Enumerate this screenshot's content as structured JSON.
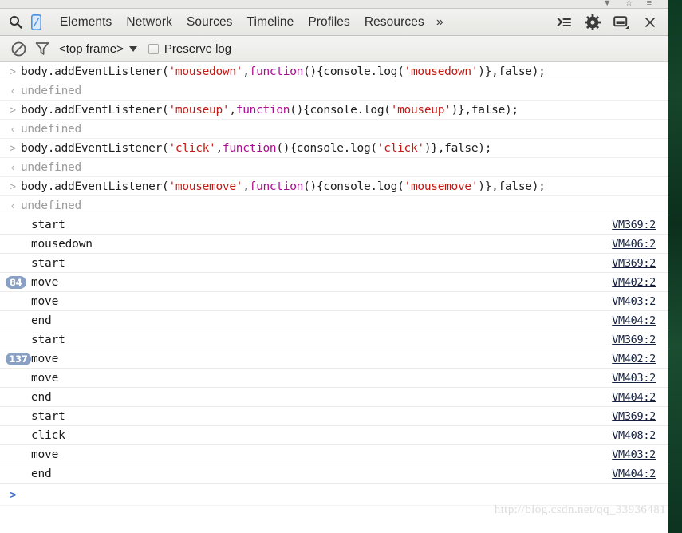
{
  "window": {
    "chrome_glyphs": "▼ ☆ ≡"
  },
  "toolbar": {
    "search_icon": "search-icon",
    "device_icon": "device-toggle-icon",
    "tabs": [
      {
        "label": "Elements"
      },
      {
        "label": "Network"
      },
      {
        "label": "Sources"
      },
      {
        "label": "Timeline"
      },
      {
        "label": "Profiles"
      },
      {
        "label": "Resources"
      }
    ],
    "overflow_label": "»",
    "right_icons": [
      {
        "name": "console-drawer-icon"
      },
      {
        "name": "gear-icon"
      },
      {
        "name": "dock-position-icon"
      },
      {
        "name": "close-icon"
      }
    ],
    "close_label": "×"
  },
  "filterbar": {
    "clear_icon": "clear-console-icon",
    "filter_icon": "filter-icon",
    "frame_label": "<top frame>",
    "frame_caret": "caret-down-icon",
    "preserve_log_label": "Preserve log",
    "preserve_log_checked": false
  },
  "console": {
    "input_marker": ">",
    "output_marker": "‹",
    "entries": [
      {
        "type": "command",
        "marker": ">",
        "tokens": [
          {
            "t": "plain",
            "v": "body.addEventListener("
          },
          {
            "t": "string",
            "v": "'mousedown'"
          },
          {
            "t": "plain",
            "v": ","
          },
          {
            "t": "keyword",
            "v": "function"
          },
          {
            "t": "plain",
            "v": "(){console.log("
          },
          {
            "t": "string",
            "v": "'mousedown'"
          },
          {
            "t": "plain",
            "v": ")},false);"
          }
        ]
      },
      {
        "type": "result",
        "marker": "‹",
        "text": "undefined"
      },
      {
        "type": "command",
        "marker": ">",
        "tokens": [
          {
            "t": "plain",
            "v": "body.addEventListener("
          },
          {
            "t": "string",
            "v": "'mouseup'"
          },
          {
            "t": "plain",
            "v": ","
          },
          {
            "t": "keyword",
            "v": "function"
          },
          {
            "t": "plain",
            "v": "(){console.log("
          },
          {
            "t": "string",
            "v": "'mouseup'"
          },
          {
            "t": "plain",
            "v": ")},false);"
          }
        ]
      },
      {
        "type": "result",
        "marker": "‹",
        "text": "undefined"
      },
      {
        "type": "command",
        "marker": ">",
        "tokens": [
          {
            "t": "plain",
            "v": "body.addEventListener("
          },
          {
            "t": "string",
            "v": "'click'"
          },
          {
            "t": "plain",
            "v": ","
          },
          {
            "t": "keyword",
            "v": "function"
          },
          {
            "t": "plain",
            "v": "(){console.log("
          },
          {
            "t": "string",
            "v": "'click'"
          },
          {
            "t": "plain",
            "v": ")},false);"
          }
        ]
      },
      {
        "type": "result",
        "marker": "‹",
        "text": "undefined"
      },
      {
        "type": "command",
        "marker": ">",
        "tokens": [
          {
            "t": "plain",
            "v": "body.addEventListener("
          },
          {
            "t": "string",
            "v": "'mousemove'"
          },
          {
            "t": "plain",
            "v": ","
          },
          {
            "t": "keyword",
            "v": "function"
          },
          {
            "t": "plain",
            "v": "(){console.log("
          },
          {
            "t": "string",
            "v": "'mousemove'"
          },
          {
            "t": "plain",
            "v": ")},false);"
          }
        ]
      },
      {
        "type": "result",
        "marker": "‹",
        "text": "undefined"
      },
      {
        "type": "log",
        "count": null,
        "message": "start",
        "source": "VM369:2"
      },
      {
        "type": "log",
        "count": null,
        "message": "mousedown",
        "source": "VM406:2"
      },
      {
        "type": "log",
        "count": null,
        "message": "start",
        "source": "VM369:2"
      },
      {
        "type": "log",
        "count": "84",
        "message": "move",
        "source": "VM402:2"
      },
      {
        "type": "log",
        "count": null,
        "message": "move",
        "source": "VM403:2"
      },
      {
        "type": "log",
        "count": null,
        "message": "end",
        "source": "VM404:2"
      },
      {
        "type": "log",
        "count": null,
        "message": "start",
        "source": "VM369:2"
      },
      {
        "type": "log",
        "count": "137",
        "message": "move",
        "source": "VM402:2"
      },
      {
        "type": "log",
        "count": null,
        "message": "move",
        "source": "VM403:2"
      },
      {
        "type": "log",
        "count": null,
        "message": "end",
        "source": "VM404:2"
      },
      {
        "type": "log",
        "count": null,
        "message": "start",
        "source": "VM369:2"
      },
      {
        "type": "log",
        "count": null,
        "message": "click",
        "source": "VM408:2"
      },
      {
        "type": "log",
        "count": null,
        "message": "move",
        "source": "VM403:2"
      },
      {
        "type": "log",
        "count": null,
        "message": "end",
        "source": "VM404:2"
      }
    ],
    "prompt_marker": ">",
    "prompt_value": ""
  },
  "watermark": {
    "text": "http://blog.csdn.net/qq_33936481"
  },
  "colors": {
    "badge": "#8a9fc4",
    "string_token": "#c41a16",
    "keyword_token": "#aa0d91",
    "link": "#16213f",
    "prompt": "#3b6fd4"
  }
}
